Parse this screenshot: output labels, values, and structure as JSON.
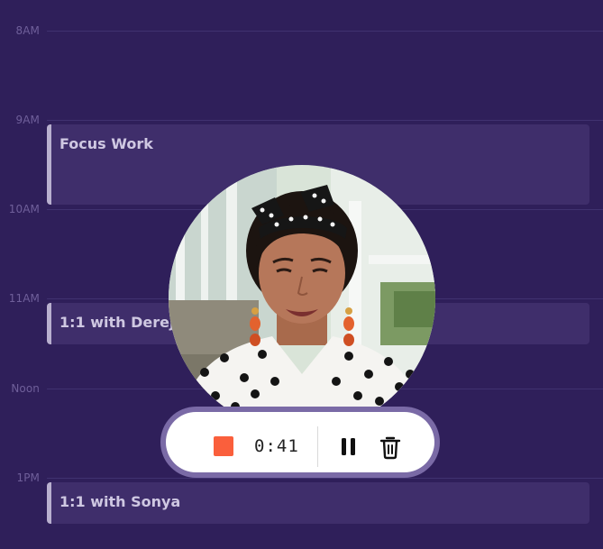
{
  "calendar": {
    "hours": [
      {
        "label": "8AM"
      },
      {
        "label": "9AM"
      },
      {
        "label": "10AM"
      },
      {
        "label": "11AM"
      },
      {
        "label": "Noon"
      },
      {
        "label": "1PM"
      }
    ],
    "events": [
      {
        "title": "Focus Work"
      },
      {
        "title": "1:1 with Dereje"
      },
      {
        "title": "1:1 with Sonya"
      }
    ]
  },
  "recorder": {
    "timer": "0:41",
    "stop_icon": "stop-icon",
    "pause_icon": "pause-icon",
    "delete_icon": "trash-icon",
    "stop_color": "#fa5f3c"
  },
  "colors": {
    "background": "#2f1f5a",
    "event_bg": "#3f2e6b",
    "event_accent": "#b9b0cf"
  }
}
